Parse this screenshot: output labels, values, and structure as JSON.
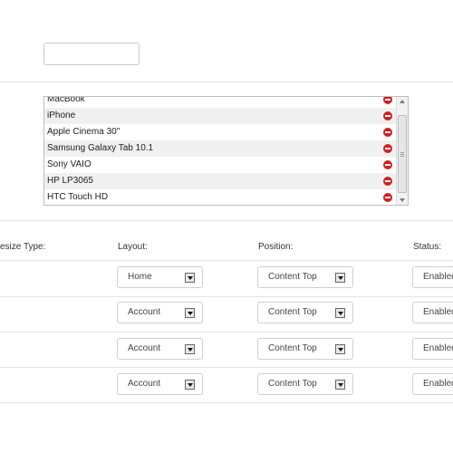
{
  "top_field": {
    "value": ""
  },
  "products": {
    "items": [
      "MacBook",
      "iPhone",
      "Apple Cinema 30\"",
      "Samsung Galaxy Tab 10.1",
      "Sony VAIO",
      "HP LP3065",
      "HTC Touch HD"
    ]
  },
  "table": {
    "headers": {
      "resize_type": "esize Type:",
      "layout": "Layout:",
      "position": "Position:",
      "status": "Status:"
    },
    "rows": [
      {
        "layout": "Home",
        "position": "Content Top",
        "status": "Enabled"
      },
      {
        "layout": "Account",
        "position": "Content Top",
        "status": "Enabled"
      },
      {
        "layout": "Account",
        "position": "Content Top",
        "status": "Enabled"
      },
      {
        "layout": "Account",
        "position": "Content Top",
        "status": "Enabled"
      }
    ]
  }
}
